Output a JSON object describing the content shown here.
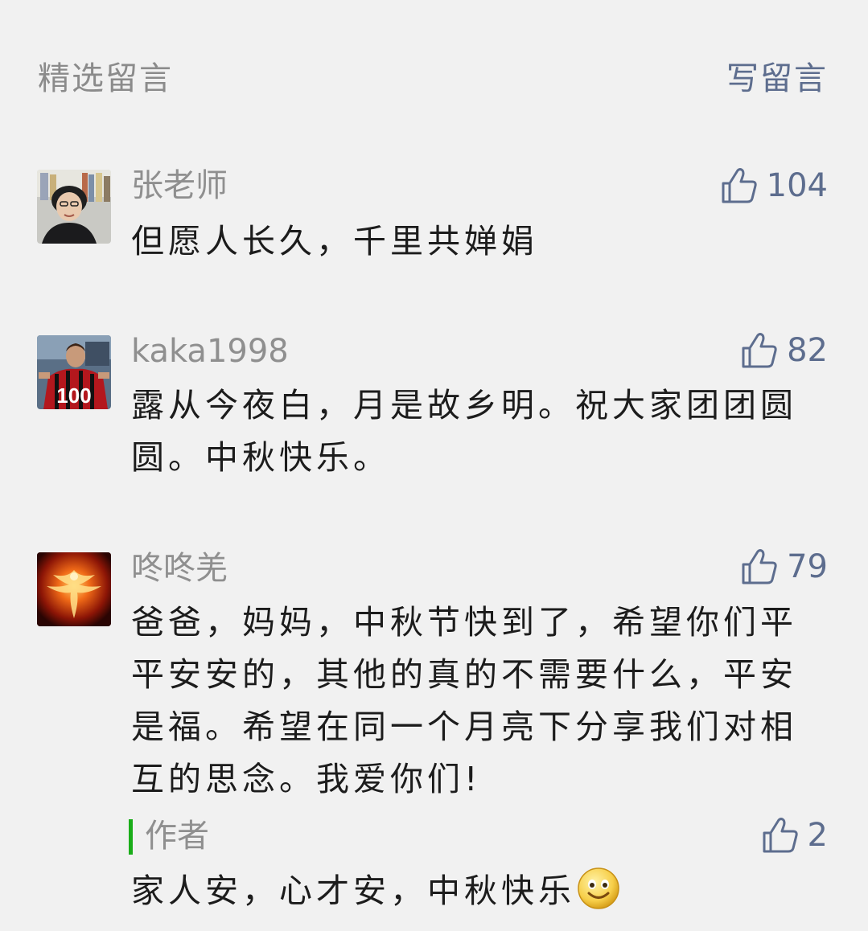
{
  "header": {
    "title": "精选留言",
    "write_label": "写留言"
  },
  "comments": [
    {
      "name": "张老师",
      "likes": "104",
      "text": "但愿人长久，千里共婵娟"
    },
    {
      "name": "kaka1998",
      "likes": "82",
      "text": "露从今夜白，月是故乡明。祝大家团团圆圆。中秋快乐。"
    },
    {
      "name": "咚咚羌",
      "likes": "79",
      "text": "爸爸，妈妈，中秋节快到了，希望你们平平安安的，其他的真的不需要什么，平安是福。希望在同一个月亮下分享我们对相互的思念。我爱你们!"
    }
  ],
  "author_reply": {
    "label": "作者",
    "likes": "2",
    "text": "家人安，心才安，中秋快乐",
    "emoji": "smile-emoji"
  },
  "colors": {
    "background": "#f1f1f1",
    "link": "#5d6d8e",
    "muted": "#8f8f8f",
    "author_accent": "#1aad19"
  }
}
